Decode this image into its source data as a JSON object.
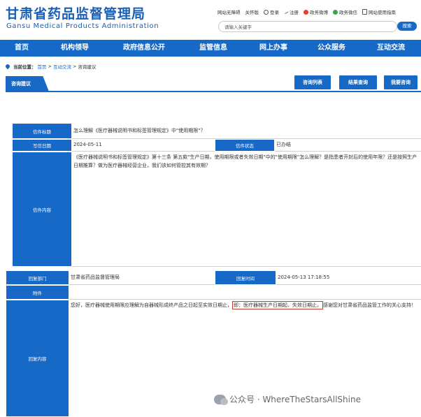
{
  "header": {
    "logo_cn": "甘肃省药品监督管理局",
    "logo_en": "Gansu Medical Products Administration",
    "top_links": [
      "网站无障碍",
      "关怀版",
      "登录",
      "注册",
      "政务微博",
      "政务微信",
      "网站使用指南"
    ],
    "search_placeholder": "请输入关键字",
    "search_button": "搜索"
  },
  "nav": [
    "首页",
    "机构领导",
    "政府信息公开",
    "监管信息",
    "网上办事",
    "公众服务",
    "互动交流"
  ],
  "breadcrumb": {
    "prefix": "当前位置：",
    "home": "首页",
    "sep1": ">",
    "section": "互动交流",
    "sep2": ">",
    "current": "咨询建议"
  },
  "tabs": {
    "active": "咨询建议",
    "buttons": [
      "咨询列表",
      "结果查询",
      "我要咨询"
    ]
  },
  "letter": {
    "title_label": "信件标题",
    "title": "怎么理解《医疗器械说明书和标签管理规定》中\"使用期限\"？",
    "date_label": "写信日期",
    "date": "2024-05-11",
    "status_label": "信件状态",
    "status": "已办结",
    "content_label": "信件内容",
    "content": "《医疗器械说明书和标签管理规定》第十三条 第五款\"生产日期，使用期限或者失效日期\"中的\"使用期限\"怎么理解？是指患者开封后的使用年限？还是按照生产日期推算？做为医疗器械经营企业，我们该如何管控其有效期？"
  },
  "reply": {
    "dept_label": "回复部门",
    "dept": "甘肃省药品监督管理局",
    "time_label": "回复时间",
    "time": "2024-05-13 17:18:55",
    "attachment_label": "附件",
    "content_label": "回复内容",
    "content_part1": "您好，医疗器械使用期限应理解为自器械形成终产品之日起至实效日期止，",
    "content_highlight": "即：医疗器械生产日期起、失效日期止。",
    "content_part2": "感谢您对甘肃省药品监管工作的关心支持！"
  },
  "watermark": "公众号 · WhereTheStarsAllShine",
  "colors": {
    "primary": "#1769c7",
    "highlight_border": "#c0392b"
  }
}
